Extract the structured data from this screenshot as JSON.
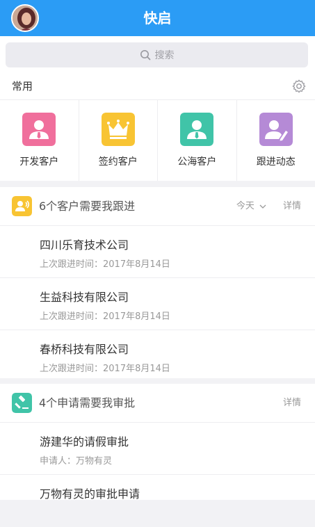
{
  "header": {
    "title": "快启"
  },
  "search": {
    "placeholder": "搜索"
  },
  "shortcuts": {
    "label": "常用",
    "items": [
      {
        "label": "开发客户",
        "icon": "person-tie-icon",
        "color": "#f06f9c"
      },
      {
        "label": "签约客户",
        "icon": "crown-icon",
        "color": "#f8c433"
      },
      {
        "label": "公海客户",
        "icon": "person-tie-icon",
        "color": "#40c4a8"
      },
      {
        "label": "跟进动态",
        "icon": "person-pen-icon",
        "color": "#b58ad6"
      }
    ]
  },
  "followup": {
    "title": "6个客户需要我跟进",
    "filter": "今天",
    "detail": "详情",
    "icon_color": "#f8c433",
    "rows": [
      {
        "name": "四川乐育技术公司",
        "sub": "上次跟进时间：2017年8月14日"
      },
      {
        "name": "生益科技有限公司",
        "sub": "上次跟进时间：2017年8月14日"
      },
      {
        "name": "春桥科技有限公司",
        "sub": "上次跟进时间：2017年8月14日"
      }
    ]
  },
  "approval": {
    "title": "4个申请需要我审批",
    "detail": "详情",
    "icon_color": "#40c4a8",
    "rows": [
      {
        "name": "游建华的请假审批",
        "sub": "申请人：万物有灵"
      },
      {
        "name": "万物有灵的审批申请",
        "sub": ""
      }
    ]
  }
}
